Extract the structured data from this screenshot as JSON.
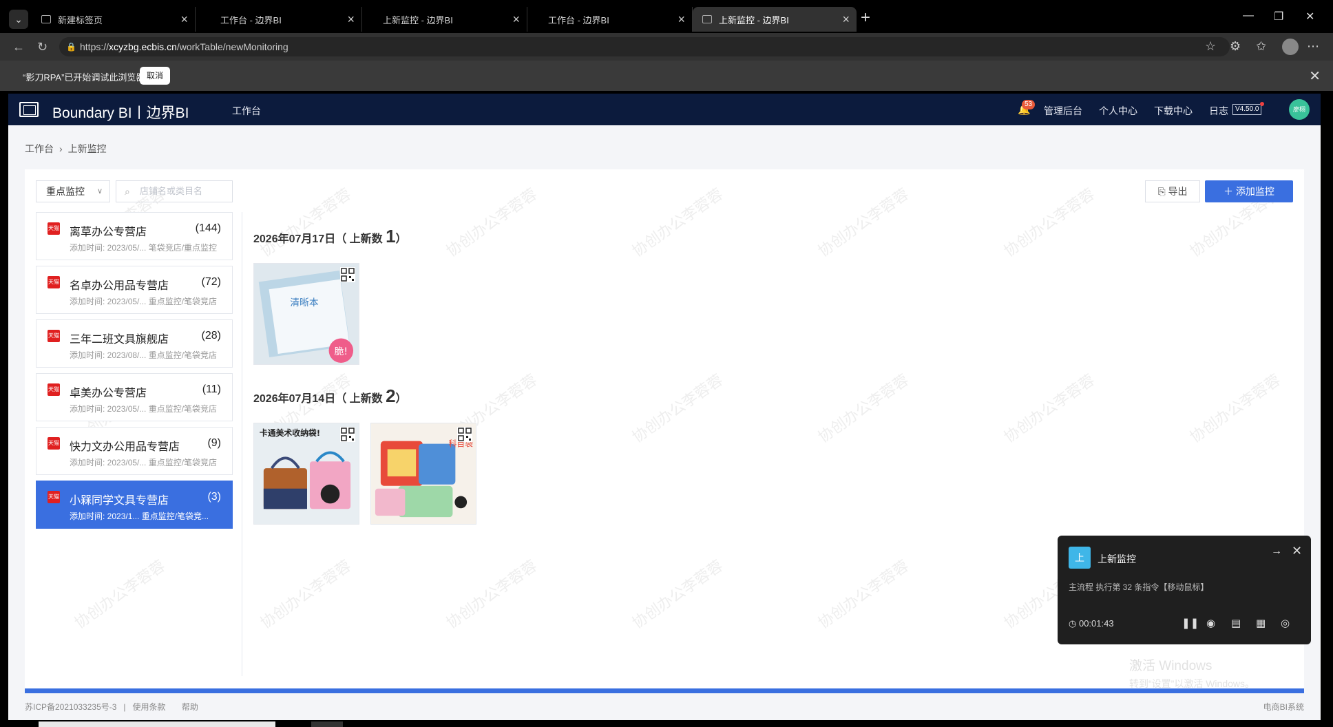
{
  "browser": {
    "tabs": [
      {
        "label": "新建标签页",
        "active": false
      },
      {
        "label": "工作台 - 边界BI",
        "active": false
      },
      {
        "label": "上新监控 - 边界BI",
        "active": false
      },
      {
        "label": "工作台 - 边界BI",
        "active": false
      },
      {
        "label": "上新监控 - 边界BI",
        "active": true
      }
    ],
    "url_prefix": "https://",
    "url_host": "xcyzbg.ecbis.cn",
    "url_path": "/workTable/newMonitoring",
    "infobar_message": "“影刀RPA”已开始调试此浏览器",
    "infobar_cancel": "取消"
  },
  "header": {
    "brand": "Boundary BI丨边界BI",
    "nav_worktable": "工作台",
    "notifications": "53",
    "admin": "管理后台",
    "profile": "个人中心",
    "downloads": "下载中心",
    "log": "日志",
    "version": "V4.50.0",
    "user_initials": "廖栩"
  },
  "breadcrumb": {
    "root": "工作台",
    "current": "上新监控"
  },
  "toolbar": {
    "filter_value": "重点监控",
    "search_placeholder": "店铺名或类目名",
    "export_label": "导出",
    "add_label": "添加监控"
  },
  "stores": [
    {
      "name": "离草办公专营店",
      "count": "(144)",
      "meta": "添加时间: 2023/05/... 笔袋竞店/重点监控",
      "selected": false
    },
    {
      "name": "名卓办公用品专营店",
      "count": "(72)",
      "meta": "添加时间: 2023/05/... 重点监控/笔袋竞店",
      "selected": false
    },
    {
      "name": "三年二班文具旗舰店",
      "count": "(28)",
      "meta": "添加时间: 2023/08/... 重点监控/笔袋竞店",
      "selected": false
    },
    {
      "name": "卓美办公专营店",
      "count": "(11)",
      "meta": "添加时间: 2023/05/... 重点监控/笔袋竞店",
      "selected": false
    },
    {
      "name": "快力文办公用品专营店",
      "count": "(9)",
      "meta": "添加时间: 2023/05/... 重点监控/笔袋竞店",
      "selected": false
    },
    {
      "name": "小槑同学文具专营店",
      "count": "(3)",
      "meta": "添加时间: 2023/1... 重点监控/笔袋竞...",
      "selected": true
    }
  ],
  "tmall_badge": "天猫",
  "days": [
    {
      "date": "2026年07月17日",
      "label_open": "（ 上新数 ",
      "count": "1",
      "label_close": "）"
    },
    {
      "date": "2026年07月14日",
      "label_open": "（ 上新数 ",
      "count": "2",
      "label_close": "）"
    }
  ],
  "products": {
    "p1_text": "清晰本",
    "p1_tag": "脆!",
    "p2_text": "卡通美术收纳袋!",
    "p3_text": "科目袋"
  },
  "footer": {
    "icp": "苏ICP备2021033235号-3",
    "terms": "使用条款",
    "help": "帮助",
    "right": "电商BI系统"
  },
  "watermark_text": "协创办公李蓉蓉",
  "rpa_popup": {
    "icon_text": "上",
    "title": "上新监控",
    "status": "主流程 执行第 32 条指令【移动鼠标】",
    "timer": "00:01:43"
  },
  "activation": {
    "line1": "激活 Windows",
    "line2": "转到“设置”以激活 Windows。"
  },
  "colors": {
    "primary": "#3a6fe0",
    "header_bg": "#0c1b3d",
    "tmall_red": "#e02020"
  }
}
